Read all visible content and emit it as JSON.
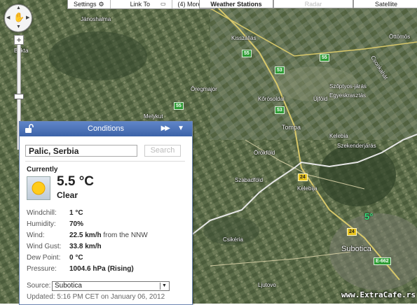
{
  "toolbar": {
    "settings": "Settings",
    "link_to": "Link To",
    "more": "(4) More...",
    "weather_stations": "Weather Stations",
    "radar": "Radar",
    "satellite": "Satellite"
  },
  "map_labels": {
    "janoshalma": "Jánoshalma",
    "kisszallas": "Kisszállás",
    "ottomos": "Öttömös",
    "bokta": "Bokta",
    "oregmajor": "Öregmajor",
    "korosoldal": "Kőrösoldal",
    "ujfold": "Újföld",
    "szoptyos": "Szőptyos-járás",
    "egyeskrasztas": "Egyeskrasztás",
    "csonkahat": "Csonkahát",
    "melykut": "Melykut",
    "tompa": "Tompa",
    "kelebia_hu": "Kelebia",
    "szekenderjaras": "Szekenderjárás",
    "orokfold": "Örökföld",
    "szabadfold": "Szabadföld",
    "kelebija": "Kelebija",
    "csikeria": "Csikéria",
    "subotica": "Subotica",
    "ljutovo": "Ljutovo",
    "road_55": "55",
    "road_53": "53",
    "road_24": "24",
    "road_e662": "E-662",
    "temp_marker": "5°"
  },
  "conditions": {
    "title": "Conditions",
    "location": "Palic, Serbia",
    "search_label": "Search",
    "currently": "Currently",
    "temperature": "5.5 °C",
    "condition": "Clear",
    "icon": "sun-icon",
    "rows": [
      {
        "label": "Windchill:",
        "value": "1 °C",
        "extra": ""
      },
      {
        "label": "Humidity:",
        "value": "70%",
        "extra": ""
      },
      {
        "label": "Wind:",
        "value": "22.5 km/h",
        "extra": " from the NNW"
      },
      {
        "label": "Wind Gust:",
        "value": "33.8 km/h",
        "extra": ""
      },
      {
        "label": "Dew Point:",
        "value": "0 °C",
        "extra": ""
      },
      {
        "label": "Pressure:",
        "value": "1004.6 hPa (Rising)",
        "extra": ""
      }
    ],
    "source_label": "Source:",
    "source_value": "Subotica",
    "updated": "Updated: 5:16 PM CET on January 06, 2012"
  },
  "watermark": "www.ExtraCafe.rs",
  "colors": {
    "panel_header": "#4a6fb5",
    "temp_marker": "#34e07a",
    "road_green": "#2f9c35",
    "road_yellow": "#e6c21e"
  }
}
